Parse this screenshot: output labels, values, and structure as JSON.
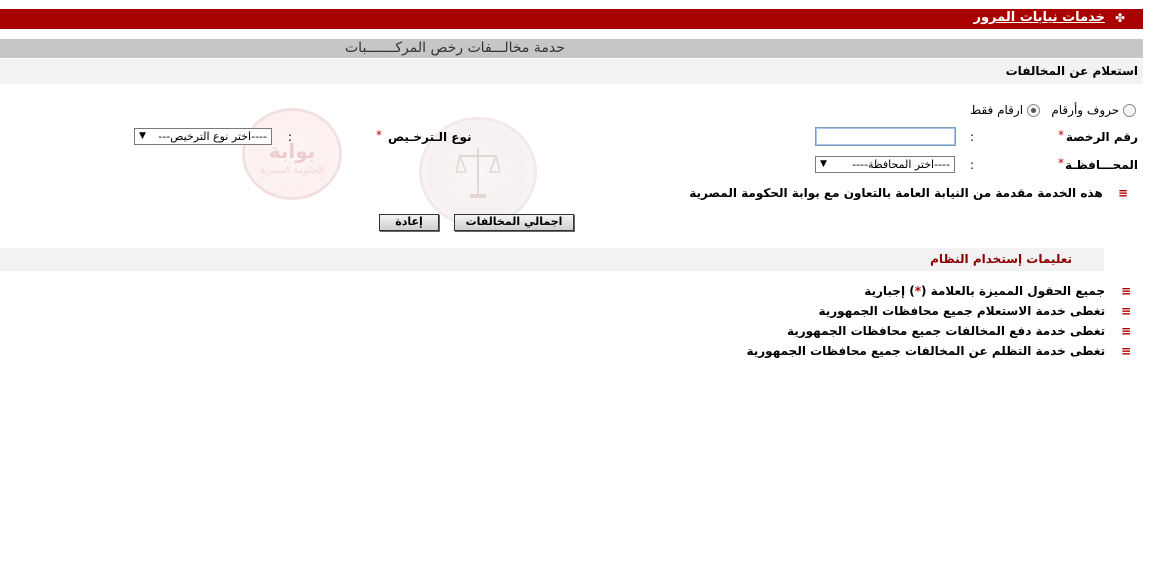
{
  "header": {
    "title": "خدمات نيابات المرور",
    "icon": "bullet-icon",
    "bar_color": "#a90000"
  },
  "service": {
    "title": "حدمة مخالـــفات رخص المركـــــــبات"
  },
  "inquiry": {
    "title": "استعلام عن المخالفات",
    "radio_letters_numbers": "حروف وأرقام",
    "radio_numbers_only": "ارقام فقط",
    "selected_radio": "ارقام فقط"
  },
  "form": {
    "license_number_label": "رقم الرخصة",
    "license_number_value": "",
    "governorate_label": "المحـــافظـة",
    "governorate_selected": "----اختر المحافظة----",
    "license_type_label": "نوع الـترخـيص",
    "license_type_selected": "----اختر نوع الترخيص---",
    "required_mark": "*",
    "colon": ":"
  },
  "note": {
    "text": "هذه الخدمة مقدمة من النيابة العامة بالتعاون مع بوابة الحكومة المصرية"
  },
  "buttons": {
    "total_violations": "اجمالي المخالفات",
    "reset": "إعادة"
  },
  "watermark": {
    "text": "بوابة",
    "sub": "الحكومة المصرية"
  },
  "instructions": {
    "title": "تعليمات إستخدام النظام",
    "items": [
      {
        "before": "جميع الحقول المميزة بالعلامة (",
        "mark": "*",
        "after": ") إجبارية"
      },
      {
        "text": "تغطى خدمة الاستعلام جميع محافظات الجمهورية"
      },
      {
        "text": "تغطى خدمة دفع المخالفات جميع محافظات الجمهورية"
      },
      {
        "text": "تغطى خدمة التظلم عن المخالفات جميع محافظات الجمهورية"
      }
    ]
  },
  "colors": {
    "accent_red": "#a90000",
    "required_red": "#c00000",
    "instructions_title": "#8a0000",
    "gray_bar": "#c6c6c6",
    "light_bar": "#f2f2f2"
  }
}
